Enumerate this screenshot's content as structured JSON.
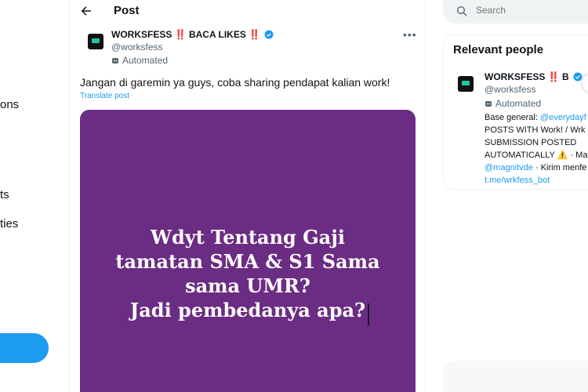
{
  "nav": {
    "items": [
      "ons",
      "ts",
      "ties"
    ]
  },
  "header": {
    "title": "Post"
  },
  "post": {
    "author_name": "WORKSFESS ‼️ BACA LIKES ‼️",
    "author_handle": "@worksfess",
    "automated_label": "Automated",
    "text": "Jangan di garemin ya guys, coba sharing pendapat kalian work!",
    "translate_label": "Translate post",
    "media_text": "Wdyt Tentang Gaji\ntamatan SMA & S1 Sama\nsama UMR?\nJadi pembedanya apa?"
  },
  "search": {
    "placeholder": "Search"
  },
  "relevant": {
    "title": "Relevant people",
    "name": "WORKSFESS ‼️ B",
    "handle": "@worksfess",
    "automated_label": "Automated",
    "bio_lines": [
      {
        "pre": "Base general: ",
        "link": "@everydayf"
      },
      {
        "pre": "POSTS WITH Work! / Wrk",
        "link": ""
      },
      {
        "pre": "SUBMISSION POSTED",
        "link": ""
      },
      {
        "pre": "AUTOMATICALLY ⚠️ · Ma",
        "link": ""
      },
      {
        "pre": "",
        "link": "@magnitvde",
        "post": " · Kirim menfe"
      },
      {
        "pre": "",
        "link": "t.me/wrkfess_bot"
      }
    ]
  },
  "colors": {
    "accent": "#1d9bf0",
    "media_bg": "#6b2c83"
  }
}
